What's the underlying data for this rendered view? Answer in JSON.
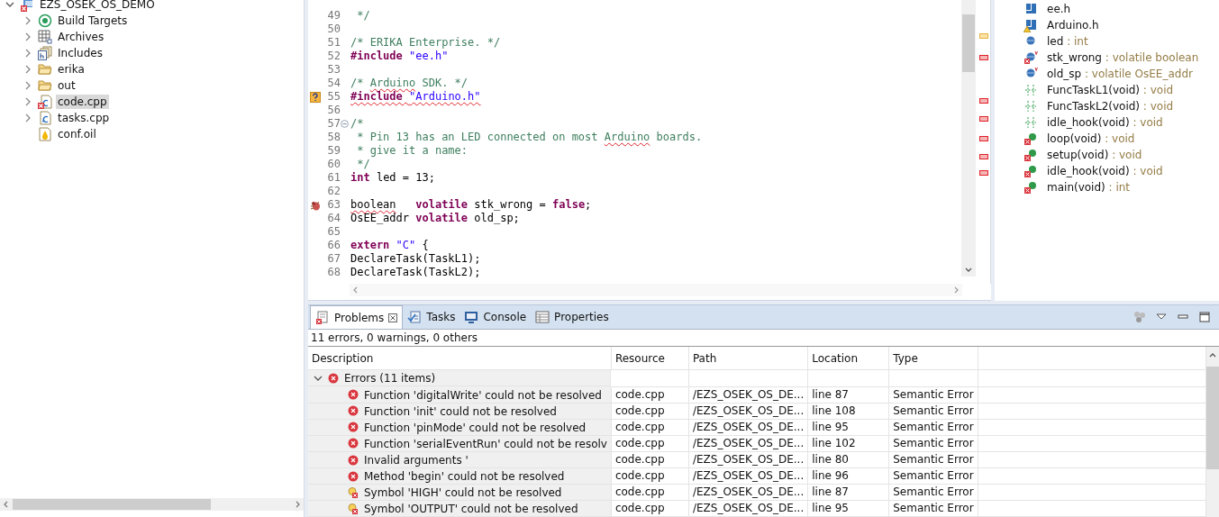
{
  "project_tree": {
    "root": {
      "label": "EZS_OSEK_OS_DEMO",
      "expanded": true,
      "children": [
        {
          "label": "Build Targets",
          "kind": "targets",
          "expandable": true,
          "selected": false
        },
        {
          "label": "Archives",
          "kind": "archives",
          "expandable": true,
          "selected": false
        },
        {
          "label": "Includes",
          "kind": "includes",
          "expandable": true,
          "selected": false
        },
        {
          "label": "erika",
          "kind": "folder",
          "expandable": true,
          "selected": false
        },
        {
          "label": "out",
          "kind": "folder",
          "expandable": true,
          "selected": false
        },
        {
          "label": "code.cpp",
          "kind": "source-error",
          "expandable": true,
          "selected": true
        },
        {
          "label": "tasks.cpp",
          "kind": "source",
          "expandable": true,
          "selected": false
        },
        {
          "label": "conf.oil",
          "kind": "oil",
          "expandable": false,
          "selected": false
        }
      ]
    }
  },
  "editor": {
    "lines": [
      {
        "number": "49",
        "kind": "plain",
        "segments": [
          {
            "kind": "comment",
            "text": " */"
          }
        ]
      },
      {
        "number": "50",
        "kind": "plain"
      },
      {
        "number": "51",
        "kind": "plain",
        "segments": [
          {
            "kind": "comment",
            "text": "/* ERIKA Enterprise. */"
          }
        ]
      },
      {
        "number": "52",
        "kind": "plain",
        "segments": [
          {
            "kind": "keyword",
            "text": "#include"
          },
          {
            "kind": "string",
            "text": " \"ee.h\""
          }
        ]
      },
      {
        "number": "53",
        "kind": "plain"
      },
      {
        "number": "54",
        "kind": "plain",
        "segments": [
          {
            "kind": "comment",
            "text": "/* "
          },
          {
            "kind": "comment-squiggle",
            "text": "Arduino"
          },
          {
            "kind": "comment",
            "text": " SDK. */"
          }
        ]
      },
      {
        "number": "55",
        "kind": "question",
        "segments": [
          {
            "kind": "keyword-squiggle",
            "text": "#include "
          },
          {
            "kind": "string-squiggle",
            "text": "\"Arduino.h\""
          }
        ]
      },
      {
        "number": "56",
        "kind": "plain"
      },
      {
        "number": "57",
        "kind": "fold",
        "segments": [
          {
            "kind": "comment",
            "text": "/*"
          }
        ]
      },
      {
        "number": "58",
        "kind": "plain",
        "segments": [
          {
            "kind": "comment",
            "text": " * Pin 13 has an LED connected on most "
          },
          {
            "kind": "comment-squiggle",
            "text": "Arduino"
          },
          {
            "kind": "comment",
            "text": " boards."
          }
        ]
      },
      {
        "number": "59",
        "kind": "plain",
        "segments": [
          {
            "kind": "comment",
            "text": " * give it a name:"
          }
        ]
      },
      {
        "number": "60",
        "kind": "plain",
        "segments": [
          {
            "kind": "comment",
            "text": " */"
          }
        ]
      },
      {
        "number": "61",
        "kind": "plain",
        "segments": [
          {
            "kind": "keyword",
            "text": "int"
          },
          {
            "kind": "plain",
            "text": " led = 13;"
          }
        ]
      },
      {
        "number": "62",
        "kind": "plain"
      },
      {
        "number": "63",
        "kind": "bug",
        "segments": [
          {
            "kind": "plain-squiggle",
            "text": "boolean"
          },
          {
            "kind": "keyword",
            "text": "   volatile"
          },
          {
            "kind": "plain",
            "text": " stk_wrong = "
          },
          {
            "kind": "keyword",
            "text": "false"
          },
          {
            "kind": "plain",
            "text": ";"
          }
        ]
      },
      {
        "number": "64",
        "kind": "plain",
        "segments": [
          {
            "kind": "plain",
            "text": "OsEE_addr "
          },
          {
            "kind": "keyword",
            "text": "volatile"
          },
          {
            "kind": "plain",
            "text": " old_sp;"
          }
        ]
      },
      {
        "number": "65",
        "kind": "plain"
      },
      {
        "number": "66",
        "kind": "plain",
        "segments": [
          {
            "kind": "keyword",
            "text": "extern"
          },
          {
            "kind": "string",
            "text": " \"C\""
          },
          {
            "kind": "plain",
            "text": " {"
          }
        ]
      },
      {
        "number": "67",
        "kind": "plain",
        "segments": [
          {
            "kind": "plain",
            "text": "DeclareTask(TaskL1);"
          }
        ]
      },
      {
        "number": "68",
        "kind": "plain",
        "segments": [
          {
            "kind": "plain",
            "text": "DeclareTask(TaskL2);"
          }
        ]
      }
    ],
    "overview_marks": [
      {
        "kind": "warning"
      },
      {
        "kind": "error"
      },
      {
        "kind": "error"
      },
      {
        "kind": "error"
      },
      {
        "kind": "error"
      },
      {
        "kind": "error"
      },
      {
        "kind": "error"
      }
    ]
  },
  "outline": {
    "items": [
      {
        "name": "ee.h",
        "kind": "header"
      },
      {
        "name": "Arduino.h",
        "kind": "header-warning"
      },
      {
        "name": "led",
        "type": " : int",
        "kind": "field"
      },
      {
        "name": "stk_wrong",
        "type": " : volatile boolean",
        "kind": "field-volatile-error"
      },
      {
        "name": "old_sp",
        "type": " : volatile OsEE_addr",
        "kind": "field-volatile"
      },
      {
        "name": "FuncTaskL1(void)",
        "type": " : void",
        "kind": "declaration"
      },
      {
        "name": "FuncTaskL2(void)",
        "type": " : void",
        "kind": "declaration"
      },
      {
        "name": "idle_hook(void)",
        "type": " : void",
        "kind": "declaration"
      },
      {
        "name": "loop(void)",
        "type": " : void",
        "kind": "function-error"
      },
      {
        "name": "setup(void)",
        "type": " : void",
        "kind": "function-error"
      },
      {
        "name": "idle_hook(void)",
        "type": " : void",
        "kind": "function-error"
      },
      {
        "name": "main(void)",
        "type": " : int",
        "kind": "function-error"
      }
    ]
  },
  "bottom_panel": {
    "tabs": [
      {
        "label": "Problems",
        "kind": "problems",
        "selected": true,
        "closable": true
      },
      {
        "label": "Tasks",
        "kind": "tasks",
        "selected": false,
        "closable": false
      },
      {
        "label": "Console",
        "kind": "console",
        "selected": false,
        "closable": false
      },
      {
        "label": "Properties",
        "kind": "properties",
        "selected": false,
        "closable": false
      }
    ],
    "summary": "11 errors, 0 warnings, 0 others",
    "columns": [
      "Description",
      "Resource",
      "Path",
      "Location",
      "Type"
    ],
    "group": {
      "label": "Errors (11 items)",
      "expanded": true
    },
    "rows": [
      {
        "kind": "error",
        "description": "Function 'digitalWrite' could not be resolved",
        "resource": "code.cpp",
        "path": "/EZS_OSEK_OS_DE...",
        "location": "line 87",
        "type": "Semantic Error"
      },
      {
        "kind": "error",
        "description": "Function 'init' could not be resolved",
        "resource": "code.cpp",
        "path": "/EZS_OSEK_OS_DE...",
        "location": "line 108",
        "type": "Semantic Error"
      },
      {
        "kind": "error",
        "description": "Function 'pinMode' could not be resolved",
        "resource": "code.cpp",
        "path": "/EZS_OSEK_OS_DE...",
        "location": "line 95",
        "type": "Semantic Error"
      },
      {
        "kind": "error",
        "description": "Function 'serialEventRun' could not be resolv",
        "resource": "code.cpp",
        "path": "/EZS_OSEK_OS_DE...",
        "location": "line 102",
        "type": "Semantic Error"
      },
      {
        "kind": "error",
        "description": "Invalid arguments '",
        "resource": "code.cpp",
        "path": "/EZS_OSEK_OS_DE...",
        "location": "line 80",
        "type": "Semantic Error"
      },
      {
        "kind": "error",
        "description": "Method 'begin' could not be resolved",
        "resource": "code.cpp",
        "path": "/EZS_OSEK_OS_DE...",
        "location": "line 96",
        "type": "Semantic Error"
      },
      {
        "kind": "symbol-error",
        "description": "Symbol 'HIGH' could not be resolved",
        "resource": "code.cpp",
        "path": "/EZS_OSEK_OS_DE...",
        "location": "line 87",
        "type": "Semantic Error"
      },
      {
        "kind": "symbol-error",
        "description": "Symbol 'OUTPUT' could not be resolved",
        "resource": "code.cpp",
        "path": "/EZS_OSEK_OS_DE...",
        "location": "line 95",
        "type": "Semantic Error"
      }
    ]
  }
}
